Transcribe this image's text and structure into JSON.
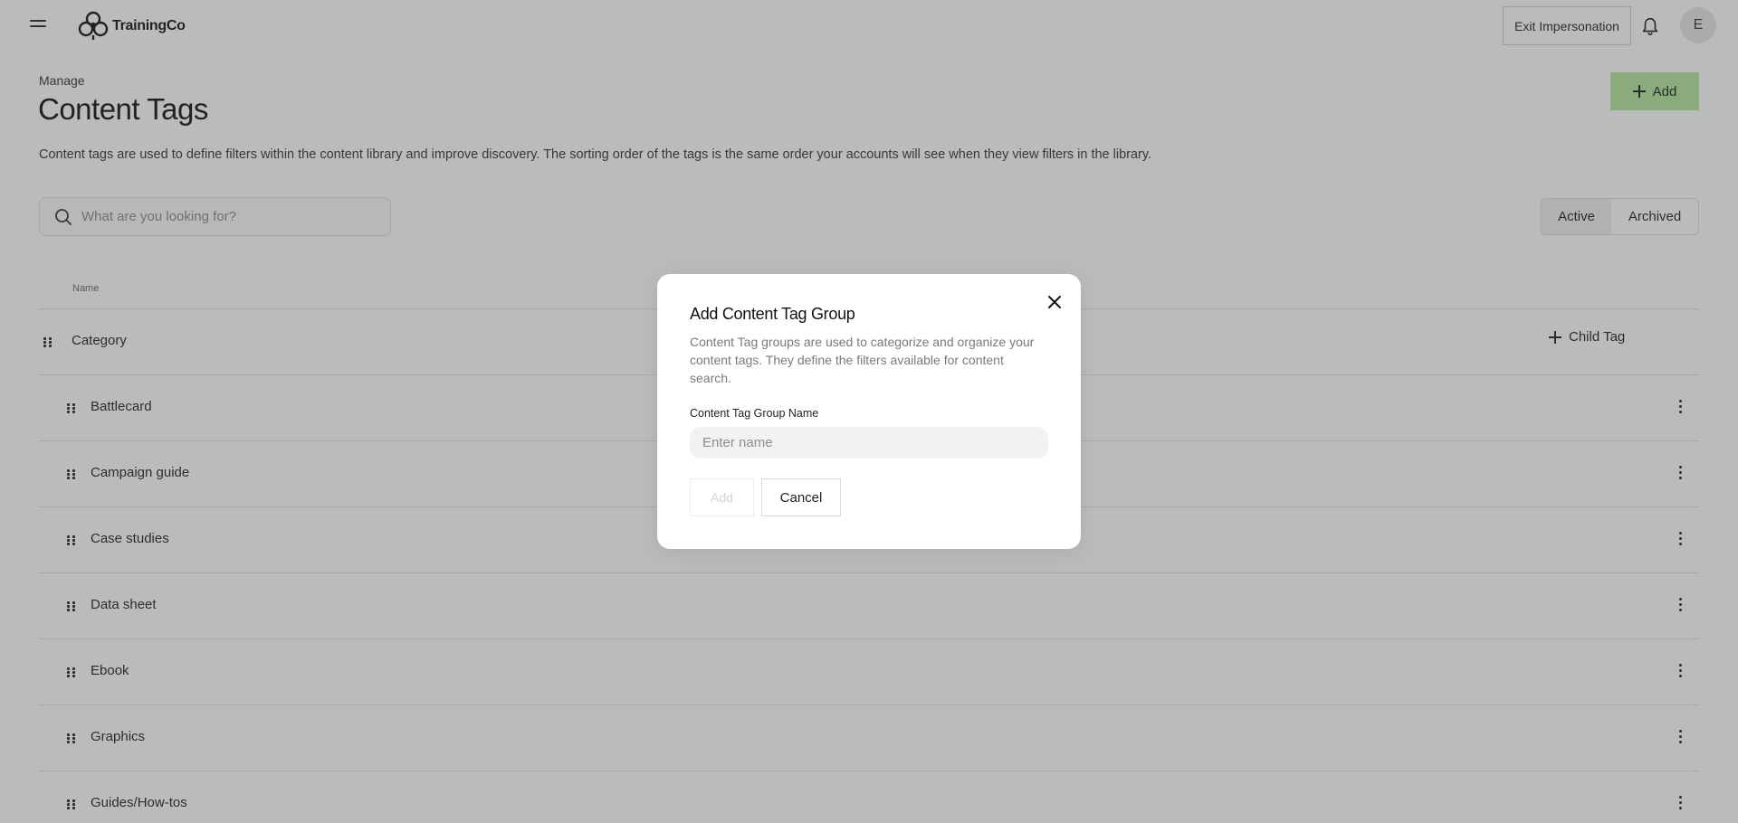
{
  "app": {
    "name": "TrainingCo",
    "exit_impersonation_label": "Exit Impersonation",
    "avatar_initial": "E"
  },
  "header": {
    "breadcrumb": "Manage",
    "title": "Content Tags",
    "add_label": "Add",
    "description": "Content tags are used to define filters within the content library and improve discovery. The sorting order of the tags is the same order your accounts will see when they view filters in the library."
  },
  "search": {
    "placeholder": "What are you looking for?",
    "value": ""
  },
  "filter_tabs": [
    {
      "label": "Active",
      "selected": true
    },
    {
      "label": "Archived",
      "selected": false
    }
  ],
  "table": {
    "column_name": "Name",
    "group": {
      "label": "Category",
      "child_tag_label": "Child Tag"
    },
    "rows": [
      {
        "label": "Battlecard"
      },
      {
        "label": "Campaign guide"
      },
      {
        "label": "Case studies"
      },
      {
        "label": "Data sheet"
      },
      {
        "label": "Ebook"
      },
      {
        "label": "Graphics"
      },
      {
        "label": "Guides/How-tos"
      }
    ]
  },
  "modal": {
    "title": "Add Content Tag Group",
    "description": "Content Tag groups are used to categorize and organize your content tags. They define the filters available for content search.",
    "field_label": "Content Tag Group Name",
    "field_placeholder": "Enter name",
    "field_value": "",
    "add_label": "Add",
    "cancel_label": "Cancel"
  },
  "colors": {
    "accent": "#b4e49b",
    "overlay": "#40464291"
  }
}
